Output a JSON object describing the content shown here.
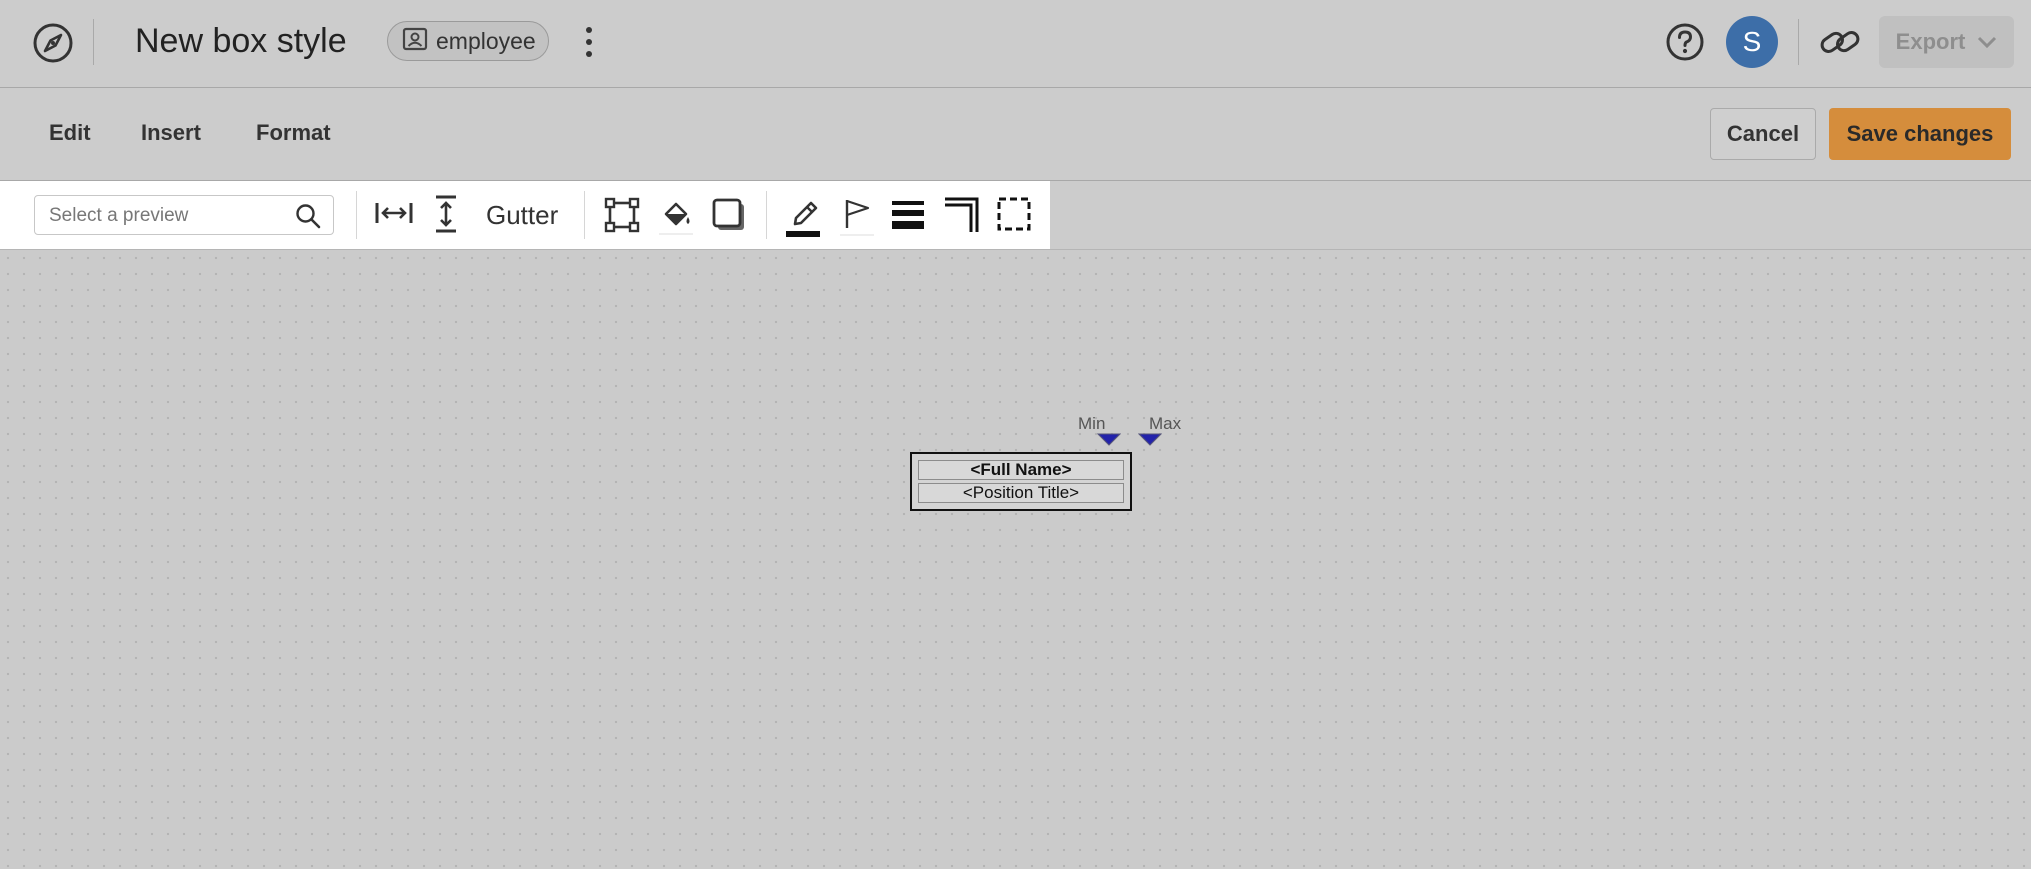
{
  "header": {
    "title": "New box style",
    "chip_label": "employee",
    "avatar_initial": "S",
    "export_label": "Export"
  },
  "menu": {
    "items": [
      "Edit",
      "Insert",
      "Format"
    ],
    "cancel_label": "Cancel",
    "save_label": "Save changes"
  },
  "toolbar": {
    "search_placeholder": "Select a preview",
    "gutter_label": "Gutter"
  },
  "canvas": {
    "box": {
      "line1": "<Full Name>",
      "line2": "<Position Title>"
    },
    "markers": {
      "min_label": "Min",
      "max_label": "Max"
    }
  },
  "colors": {
    "avatar": "#3d6ea8",
    "save_button": "#d58d3c",
    "marker": "#2222aa"
  }
}
